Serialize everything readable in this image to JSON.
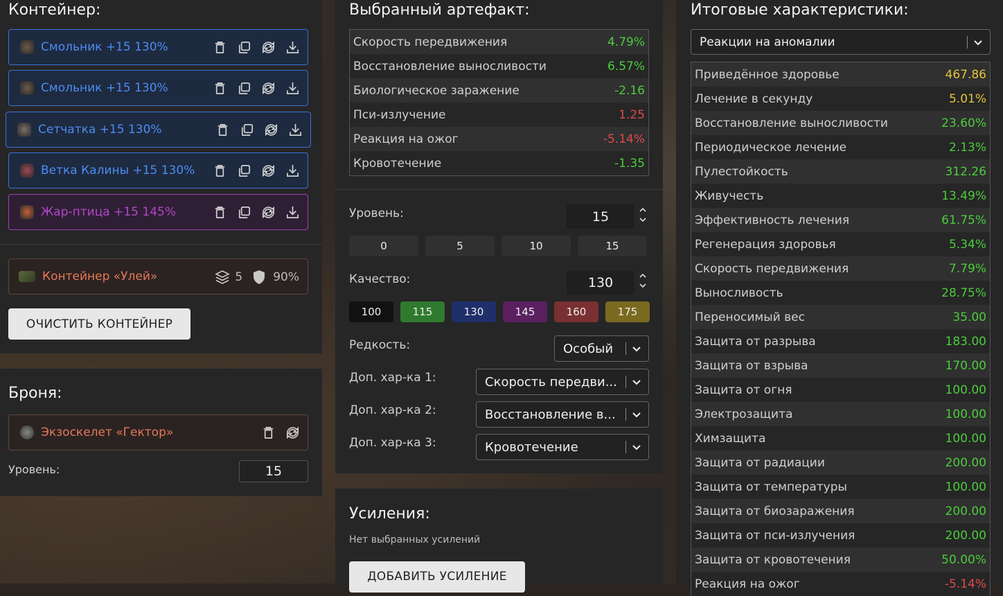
{
  "container": {
    "title": "Контейнер:",
    "items": [
      {
        "label": "Смольник +15 130%",
        "style": "blue"
      },
      {
        "label": "Смольник +15 130%",
        "style": "blue"
      },
      {
        "label": "Сетчатка +15 130%",
        "style": "blue"
      },
      {
        "label": "Ветка Калины +15 130%",
        "style": "blue"
      },
      {
        "label": "Жар-птица +15 145%",
        "style": "purple"
      }
    ],
    "box": {
      "label": "Контейнер «Улей»",
      "slots": "5",
      "protection": "90%"
    },
    "clear_label": "ОЧИСТИТЬ КОНТЕЙНЕР"
  },
  "armor": {
    "title": "Броня:",
    "item_label": "Экзоскелет «Гектор»",
    "level_label": "Уровень:",
    "level_value": "15"
  },
  "artifact": {
    "title": "Выбранный артефакт:",
    "stats": [
      {
        "name": "Скорость передвижения",
        "value": "4.79%",
        "tone": "pos"
      },
      {
        "name": "Восстановление выносливости",
        "value": "6.57%",
        "tone": "pos"
      },
      {
        "name": "Биологическое заражение",
        "value": "-2.16",
        "tone": "pos"
      },
      {
        "name": "Пси-излучение",
        "value": "1.25",
        "tone": "neg"
      },
      {
        "name": "Реакция на ожог",
        "value": "-5.14%",
        "tone": "neg"
      },
      {
        "name": "Кровотечение",
        "value": "-1.35",
        "tone": "pos"
      }
    ],
    "level_label": "Уровень:",
    "level_value": "15",
    "level_presets": [
      "0",
      "5",
      "10",
      "15"
    ],
    "quality_label": "Качество:",
    "quality_value": "130",
    "quality_presets": [
      {
        "label": "100",
        "color": "#111111"
      },
      {
        "label": "115",
        "color": "#2f7a2f"
      },
      {
        "label": "130",
        "color": "#1f2f6a"
      },
      {
        "label": "145",
        "color": "#5a2060"
      },
      {
        "label": "160",
        "color": "#7a3030"
      },
      {
        "label": "175",
        "color": "#7a6a20"
      }
    ],
    "rarity_label": "Редкость:",
    "rarity_value": "Особый",
    "extra1_label": "Доп. хар-ка 1:",
    "extra1_value": "Скорость передви...",
    "extra2_label": "Доп. хар-ка 2:",
    "extra2_value": "Восстановление в...",
    "extra3_label": "Доп. хар-ка 3:",
    "extra3_value": "Кровотечение"
  },
  "boosts": {
    "title": "Усиления:",
    "empty": "Нет выбранных усилений",
    "add_label": "ДОБАВИТЬ УСИЛЕНИЕ"
  },
  "totals": {
    "title": "Итоговые характеристики:",
    "filter_value": "Реакции на аномалии",
    "stats": [
      {
        "name": "Приведённое здоровье",
        "value": "467.86",
        "tone": "gold"
      },
      {
        "name": "Лечение в секунду",
        "value": "5.01%",
        "tone": "gold"
      },
      {
        "name": "Восстановление выносливости",
        "value": "23.60%",
        "tone": "pos"
      },
      {
        "name": "Периодическое лечение",
        "value": "2.13%",
        "tone": "pos"
      },
      {
        "name": "Пулестойкость",
        "value": "312.26",
        "tone": "pos"
      },
      {
        "name": "Живучесть",
        "value": "13.49%",
        "tone": "pos"
      },
      {
        "name": "Эффективность лечения",
        "value": "61.75%",
        "tone": "pos"
      },
      {
        "name": "Регенерация здоровья",
        "value": "5.34%",
        "tone": "pos"
      },
      {
        "name": "Скорость передвижения",
        "value": "7.79%",
        "tone": "pos"
      },
      {
        "name": "Выносливость",
        "value": "28.75%",
        "tone": "pos"
      },
      {
        "name": "Переносимый вес",
        "value": "35.00",
        "tone": "pos"
      },
      {
        "name": "Защита от разрыва",
        "value": "183.00",
        "tone": "pos"
      },
      {
        "name": "Защита от взрыва",
        "value": "170.00",
        "tone": "pos"
      },
      {
        "name": "Защита от огня",
        "value": "100.00",
        "tone": "pos"
      },
      {
        "name": "Электрозащита",
        "value": "100.00",
        "tone": "pos"
      },
      {
        "name": "Химзащита",
        "value": "100.00",
        "tone": "pos"
      },
      {
        "name": "Защита от радиации",
        "value": "200.00",
        "tone": "pos"
      },
      {
        "name": "Защита от температуры",
        "value": "100.00",
        "tone": "pos"
      },
      {
        "name": "Защита от биозаражения",
        "value": "200.00",
        "tone": "pos"
      },
      {
        "name": "Защита от пси-излучения",
        "value": "200.00",
        "tone": "pos"
      },
      {
        "name": "Защита от кровотечения",
        "value": "50.00%",
        "tone": "pos"
      },
      {
        "name": "Реакция на ожог",
        "value": "-5.14%",
        "tone": "neg"
      }
    ]
  }
}
